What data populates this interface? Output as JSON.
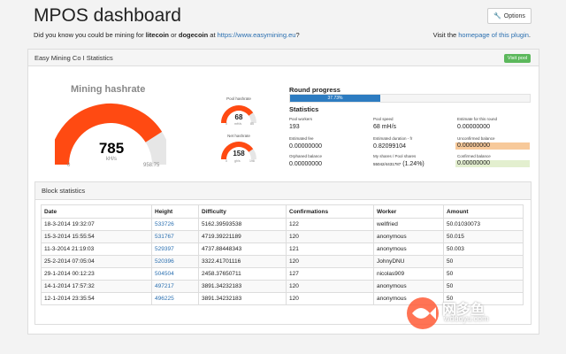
{
  "header": {
    "title": "MPOS dashboard",
    "tagline_prefix": "Did you know you could be mining for ",
    "coin1": "litecoin",
    "tagline_or": " or ",
    "coin2": "dogecoin",
    "tagline_at": " at ",
    "url": "https://www.easymining.eu",
    "tagline_q": "?",
    "visit_prefix": "Visit the ",
    "visit_link": "homepage of this plugin",
    "visit_suffix": ".",
    "options_label": "Options"
  },
  "panel": {
    "title": "Easy Mining Co I Statistics",
    "visit_pool": "Visit pool"
  },
  "hashrate": {
    "title": "Mining hashrate",
    "value": "785",
    "unit": "kH/s",
    "min": "0",
    "max": "958.75",
    "fraction": 0.819
  },
  "pool_hashrate": {
    "title": "Pool hashrate",
    "value": "68",
    "unit": "mH/s",
    "min": "0",
    "max": "85",
    "fraction": 0.8
  },
  "net_hashrate": {
    "title": "Net hashrate",
    "value": "158",
    "unit": "gh/s",
    "min": "0",
    "max": "198",
    "fraction": 0.8
  },
  "round": {
    "title": "Round progress",
    "percent_text": "37.73%",
    "fraction": 0.3773
  },
  "statistics": {
    "title": "Statistics",
    "pool_workers_label": "Pool workers",
    "pool_workers": "193",
    "pool_speed_label": "Pool speed",
    "pool_speed": "68 mH/s",
    "estimate_label": "Estimate for this round",
    "estimate": "0.00000000",
    "est_fee_label": "Estimated fee",
    "est_fee": "0.00000000",
    "est_duration_label": "Estimated duration - fr",
    "est_duration": "0.82099104",
    "unconfirmed_label": "Unconfirmed balance",
    "unconfirmed": "0.00000000",
    "orphaned_label": "Orphaned balance",
    "orphaned": "0.00000000",
    "shares_label": "My shares / Pool shares",
    "shares_small": "55042/4431787",
    "shares_pct": "(1.24%)",
    "confirmed_label": "Confirmed balance",
    "confirmed": "0.00000000",
    "colors": {
      "unconfirmed": "#f7c99a",
      "confirmed": "#e3efcf"
    }
  },
  "blocks": {
    "title": "Block statistics",
    "columns": [
      "Date",
      "Height",
      "Difficulty",
      "Confirmations",
      "Worker",
      "Amount"
    ],
    "rows": [
      [
        "18-3-2014 19:32:07",
        "533726",
        "5162.39593538",
        "122",
        "wellfried",
        "50.01030073"
      ],
      [
        "15-3-2014 15:55:54",
        "531767",
        "4719.39221189",
        "120",
        "anonymous",
        "50.015"
      ],
      [
        "11-3-2014 21:19:03",
        "529397",
        "4737.88448343",
        "121",
        "anonymous",
        "50.003"
      ],
      [
        "25-2-2014 07:05:04",
        "520396",
        "3322.41701116",
        "120",
        "JohnyDNU",
        "50"
      ],
      [
        "29-1-2014 00:12:23",
        "504504",
        "2458.37650711",
        "127",
        "nicolas909",
        "50"
      ],
      [
        "14-1-2014 17:57:32",
        "497217",
        "3891.34232183",
        "120",
        "anonymous",
        "50"
      ],
      [
        "12-1-2014 23:35:54",
        "496225",
        "3891.34232183",
        "120",
        "anonymous",
        "50"
      ]
    ]
  },
  "watermark": {
    "text": "网多鱼",
    "url": "wduoyu.com"
  },
  "colors": {
    "gauge_fill": "#ff4a12",
    "gauge_track": "#e6e6e6",
    "progress": "#2d7cc1",
    "link": "#2a6fb0",
    "visit_pool": "#5cb85c"
  }
}
